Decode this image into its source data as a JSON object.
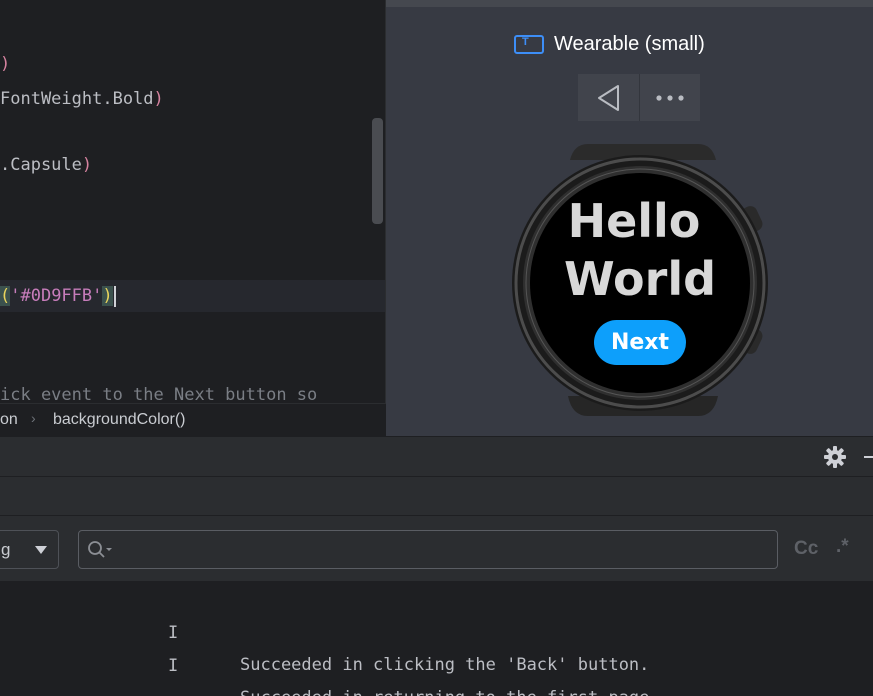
{
  "editor": {
    "lines": {
      "l1_paren": ")",
      "l2_text": "FontWeight.Bold",
      "l2_paren": ")",
      "l3_text": ".Capsule",
      "l3_paren": ")",
      "l4_open": "(",
      "l4_string": "'#0D9FFB'",
      "l4_close": ")",
      "l5_comment": "ick event to the Next button so"
    }
  },
  "breadcrumb": {
    "item1": "on",
    "separator": "›",
    "item2": "backgroundColor()"
  },
  "previewer": {
    "device_icon_letter": "T",
    "device_name": "Wearable (small)",
    "back_icon": "back-triangle-icon",
    "more_icon": "more-dots-icon",
    "screen": {
      "title_line1": "Hello",
      "title_line2": "World",
      "button_label": "Next",
      "button_color": "#0D9FFB"
    }
  },
  "log_panel": {
    "level_select_value": "g",
    "search_placeholder": "",
    "match_case_label": "Cc",
    "regex_label": ".*",
    "rows": [
      {
        "level": "I",
        "message": "Succeeded in clicking the 'Back' button."
      },
      {
        "level": "I",
        "message": "Succeeded in returning to the first page."
      }
    ]
  }
}
